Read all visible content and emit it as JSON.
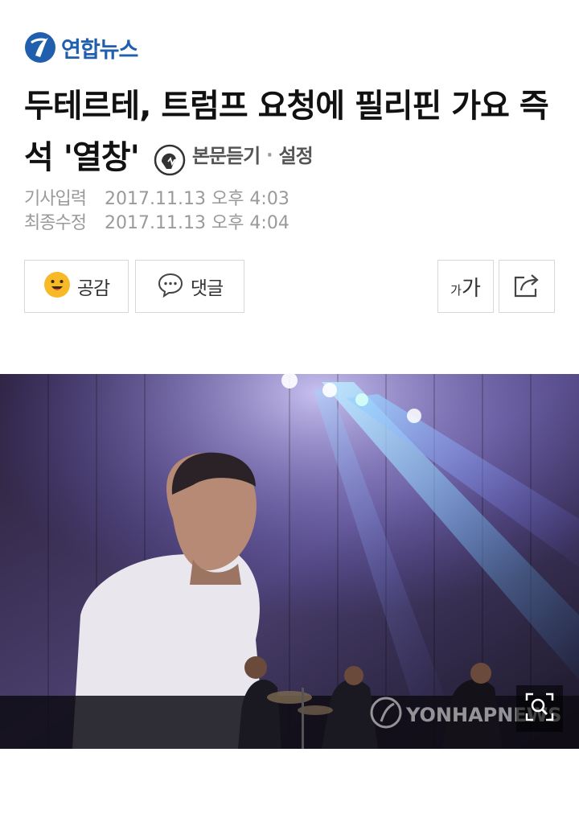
{
  "brand": {
    "name": "연합뉴스"
  },
  "article": {
    "title": "두테르테, 트럼프 요청에 필리핀 가요 즉석 '열창'",
    "tts": {
      "listen_label": "본문듣기",
      "separator": "·",
      "settings_label": "설정"
    },
    "meta": {
      "published_label": "기사입력",
      "published_value": "2017.11.13 오후 4:03",
      "updated_label": "최종수정",
      "updated_value": "2017.11.13 오후 4:04"
    }
  },
  "actions": {
    "like_label": "공감",
    "comment_label": "댓글",
    "font_small": "가",
    "font_big": "가"
  },
  "photo": {
    "watermark": "YONHAPNEWS"
  },
  "colors": {
    "brand_blue": "#1f5fae",
    "meta_gray": "#9a9a9a",
    "border": "#d8d8d8"
  }
}
